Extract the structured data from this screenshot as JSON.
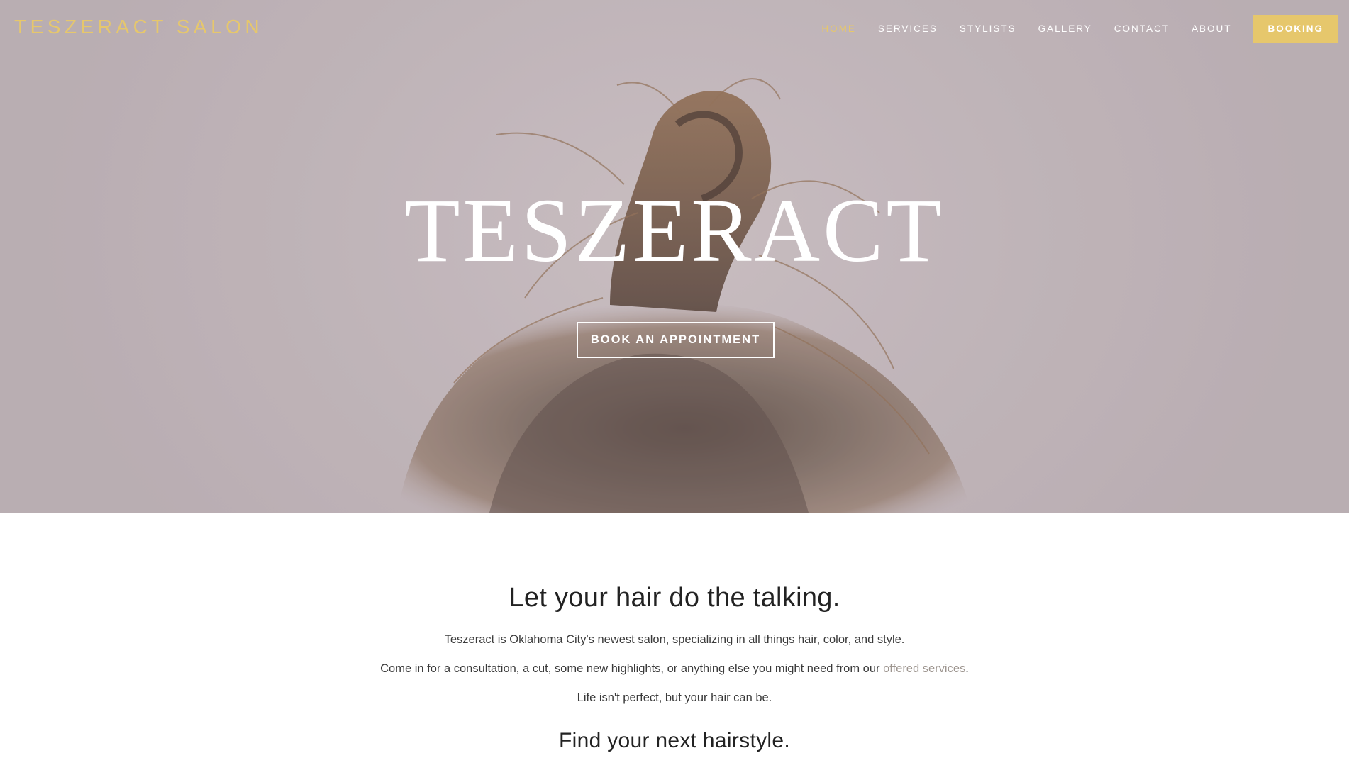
{
  "brand": {
    "logo_text": "TESZERACT SALON",
    "accent_color": "#e6c76c"
  },
  "nav": {
    "items": [
      {
        "label": "HOME",
        "active": true
      },
      {
        "label": "SERVICES",
        "active": false
      },
      {
        "label": "STYLISTS",
        "active": false
      },
      {
        "label": "GALLERY",
        "active": false
      },
      {
        "label": "CONTACT",
        "active": false
      },
      {
        "label": "ABOUT",
        "active": false
      }
    ],
    "booking_label": "BOOKING"
  },
  "hero": {
    "title": "TESZERACT",
    "cta_label": "BOOK AN APPOINTMENT"
  },
  "content": {
    "heading": "Let your hair do the talking.",
    "paragraph_1": "Teszeract is Oklahoma City's newest salon, specializing in all things hair, color, and style.",
    "paragraph_2_prefix": "Come in for a consultation, a cut, some new highlights, or anything else you might need from our ",
    "paragraph_2_link": "offered services",
    "paragraph_2_suffix": ".",
    "paragraph_3": "Life isn't perfect, but your hair can be.",
    "subheading": "Find your next hairstyle."
  }
}
